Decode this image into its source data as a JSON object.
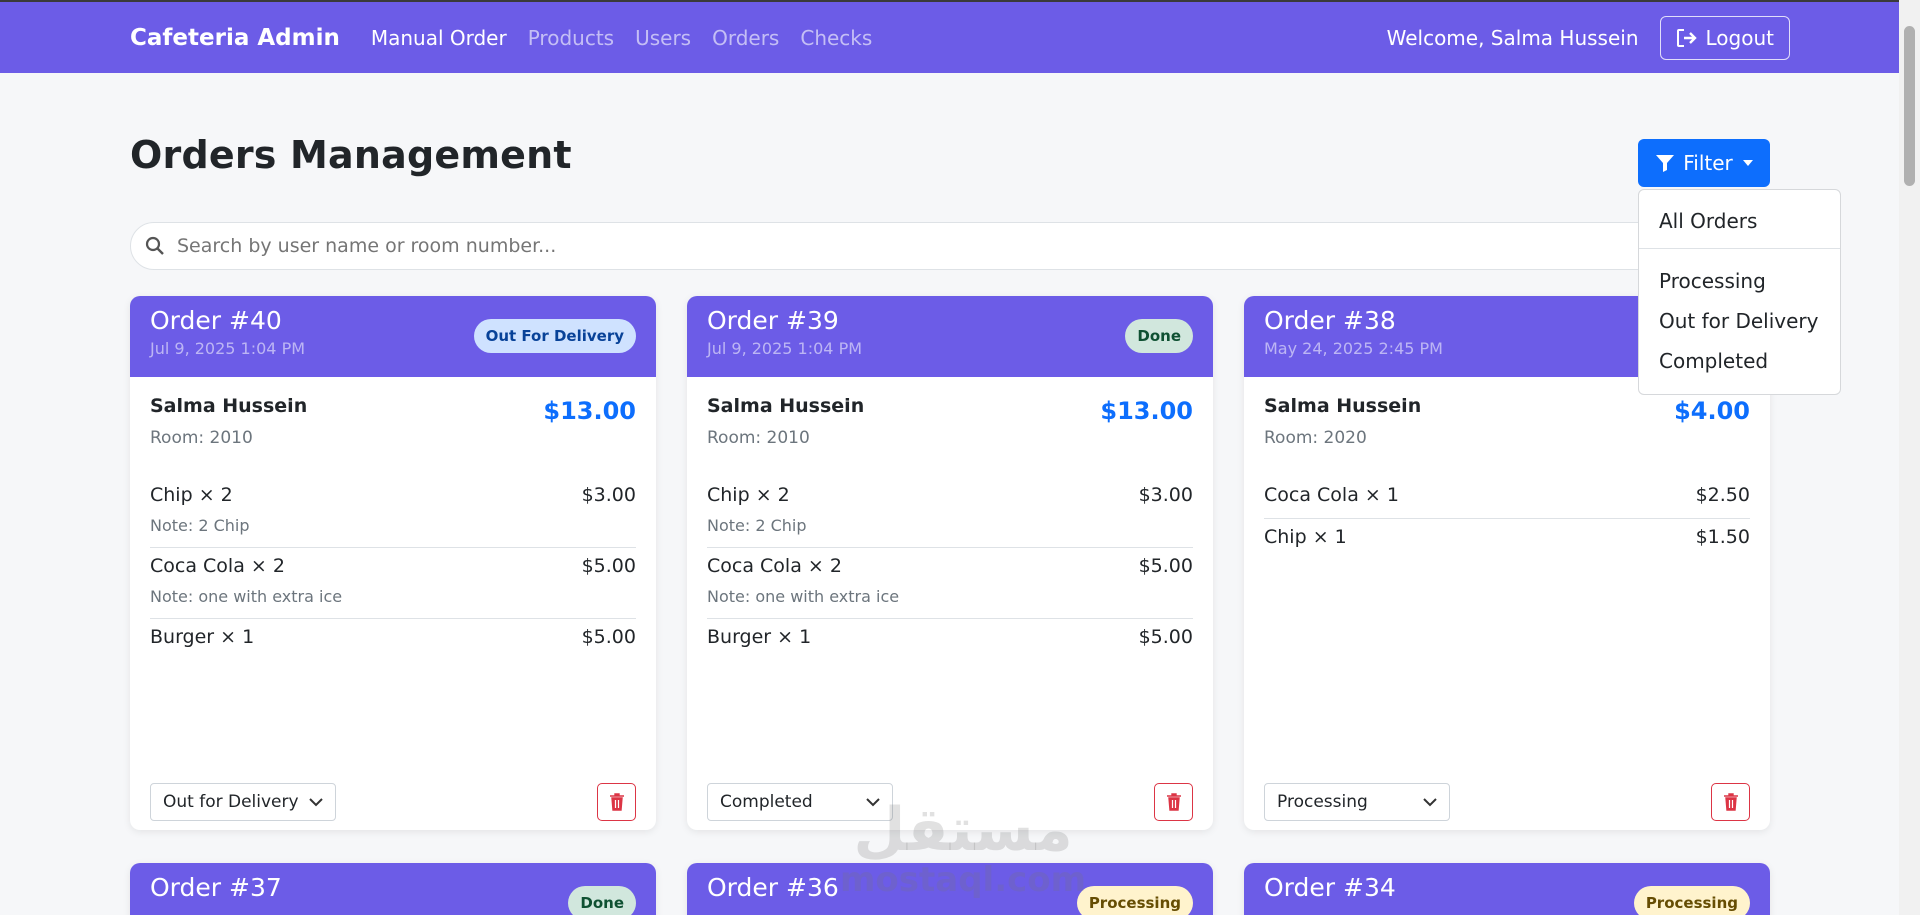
{
  "navbar": {
    "brand": "Cafeteria Admin",
    "links": [
      "Manual Order",
      "Products",
      "Users",
      "Orders",
      "Checks"
    ],
    "welcome": "Welcome, Salma Hussein",
    "logout": "Logout"
  },
  "page": {
    "title": "Orders Management",
    "filter_label": "Filter",
    "search_placeholder": "Search by user name or room number..."
  },
  "filter_menu": {
    "all": "All Orders",
    "options": [
      "Processing",
      "Out for Delivery",
      "Completed"
    ]
  },
  "orders": [
    {
      "id": "Order #40",
      "date": "Jul 9, 2025 1:04 PM",
      "badge": "Out For Delivery",
      "customer": "Salma Hussein",
      "room": "Room: 2010",
      "total": "$13.00",
      "items": [
        {
          "name": "Chip × 2",
          "price": "$3.00",
          "note": "Note: 2 Chip"
        },
        {
          "name": "Coca Cola × 2",
          "price": "$5.00",
          "note": "Note: one with extra ice"
        },
        {
          "name": "Burger × 1",
          "price": "$5.00"
        }
      ],
      "status": "Out for Delivery"
    },
    {
      "id": "Order #39",
      "date": "Jul 9, 2025 1:04 PM",
      "badge": "Done",
      "customer": "Salma Hussein",
      "room": "Room: 2010",
      "total": "$13.00",
      "items": [
        {
          "name": "Chip × 2",
          "price": "$3.00",
          "note": "Note: 2 Chip"
        },
        {
          "name": "Coca Cola × 2",
          "price": "$5.00",
          "note": "Note: one with extra ice"
        },
        {
          "name": "Burger × 1",
          "price": "$5.00"
        }
      ],
      "status": "Completed"
    },
    {
      "id": "Order #38",
      "date": "May 24, 2025 2:45 PM",
      "customer": "Salma Hussein",
      "room": "Room: 2020",
      "total": "$4.00",
      "items": [
        {
          "name": "Coca Cola × 1",
          "price": "$2.50"
        },
        {
          "name": "Chip × 1",
          "price": "$1.50"
        }
      ],
      "status": "Processing"
    },
    {
      "id": "Order #37",
      "badge": "Done"
    },
    {
      "id": "Order #36",
      "badge": "Processing"
    },
    {
      "id": "Order #34",
      "badge": "Processing"
    }
  ],
  "watermark": {
    "arabic": "مستقل",
    "latin": "mostaql.com"
  },
  "colors": {
    "navbar": "#6c5ce7",
    "primary": "#0d6efd",
    "danger": "#dc3545"
  }
}
